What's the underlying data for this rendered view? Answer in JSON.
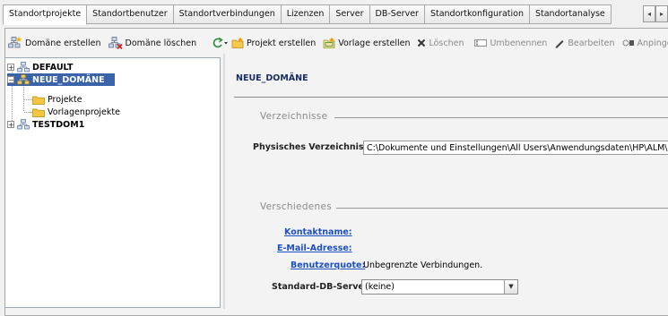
{
  "tabs": [
    {
      "label": "Standortprojekte",
      "active": true
    },
    {
      "label": "Standortbenutzer",
      "active": false
    },
    {
      "label": "Standortverbindungen",
      "active": false
    },
    {
      "label": "Lizenzen",
      "active": false
    },
    {
      "label": "Server",
      "active": false
    },
    {
      "label": "DB-Server",
      "active": false
    },
    {
      "label": "Standortkonfiguration",
      "active": false
    },
    {
      "label": "Standortanalyse",
      "active": false
    }
  ],
  "tab_scroll": {
    "left": "◂",
    "right": "▸"
  },
  "left_toolbar": {
    "create_domain": "Domäne erstellen",
    "delete_domain": "Domäne löschen"
  },
  "right_toolbar": {
    "create_project": "Projekt erstellen",
    "create_template": "Vorlage erstellen",
    "delete": "Löschen",
    "rename": "Umbenennen",
    "edit": "Bearbeiten",
    "attach": "Anpingen",
    "more": "»"
  },
  "tree": {
    "default": "DEFAULT",
    "neue_domaene": "NEUE_DOMÄNE",
    "projekte": "Projekte",
    "vorlagenprojekte": "Vorlagenprojekte",
    "testdom": "TESTDOM1",
    "expand_plus": "+",
    "expand_minus": "−"
  },
  "detail": {
    "domain_title": "NEUE_DOMÄNE",
    "section_directories": "Verzeichnisse",
    "physical_dir_label": "Physisches Verzeichnis:",
    "physical_dir_value": "C:\\Dokumente und Einstellungen\\All Users\\Anwendungsdaten\\HP\\ALM\\repository",
    "section_misc": "Verschiedenes",
    "contact_label": "Kontaktname:",
    "email_label": "E-Mail-Adresse:",
    "quota_label": "Benutzerquote:",
    "quota_value": "Unbegrenzte Verbindungen.",
    "dbserver_label": "Standard-DB-Server:",
    "dbserver_value": "(keine)"
  },
  "colors": {
    "selection": "#3a63a9",
    "link": "#1d4fc4",
    "title": "#1b2e62"
  }
}
